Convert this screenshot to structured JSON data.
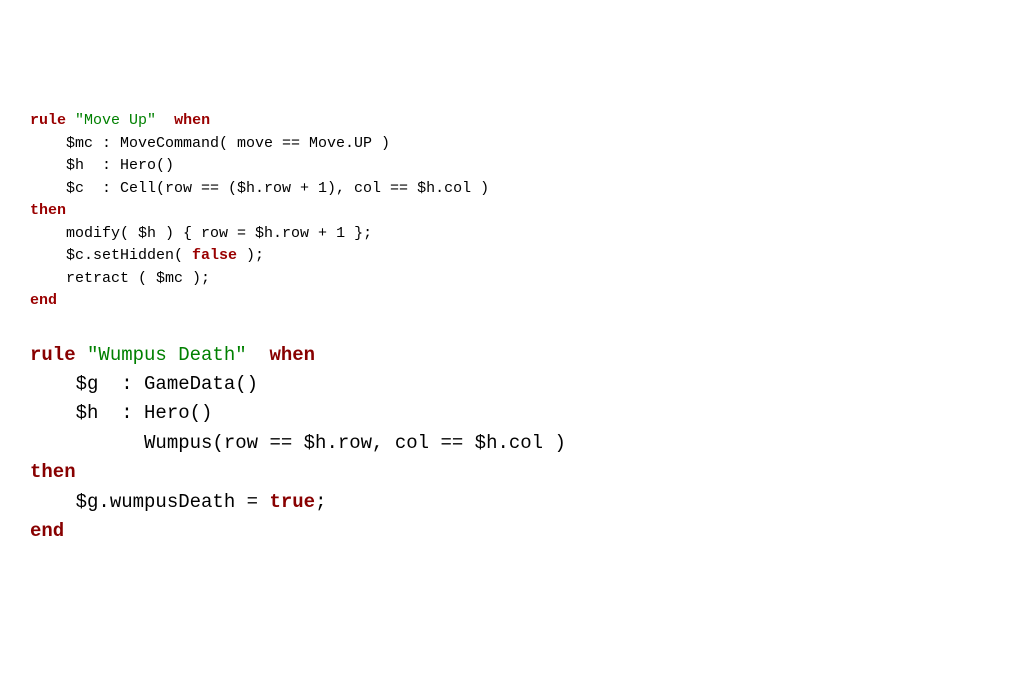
{
  "rule1": {
    "kw_rule": "rule",
    "name": "\"Move Up\"",
    "kw_when": "when",
    "line2": "    $mc : MoveCommand( move == Move.UP )",
    "line3": "    $h  : Hero()",
    "line4": "    $c  : Cell(row == ($h.row + 1), col == $h.col )",
    "kw_then": "then",
    "line6a": "    modify( $h ) { row = $h.row + ",
    "line6b": "1",
    "line6c": " };",
    "line7a": "    $c.setHidden( ",
    "line7b": "false",
    "line7c": " );",
    "line8": "    retract ( $mc );",
    "kw_end": "end"
  },
  "rule2": {
    "kw_rule": "rule",
    "name": "\"Wumpus Death\"",
    "kw_when": "when",
    "line2": "    $g  : GameData()",
    "line3": "    $h  : Hero()",
    "line4": "          Wumpus(row == $h.row, col == $h.col )",
    "kw_then": "then",
    "line6a": "    $g.wumpusDeath = ",
    "line6b": "true",
    "line6c": ";",
    "kw_end": "end"
  }
}
